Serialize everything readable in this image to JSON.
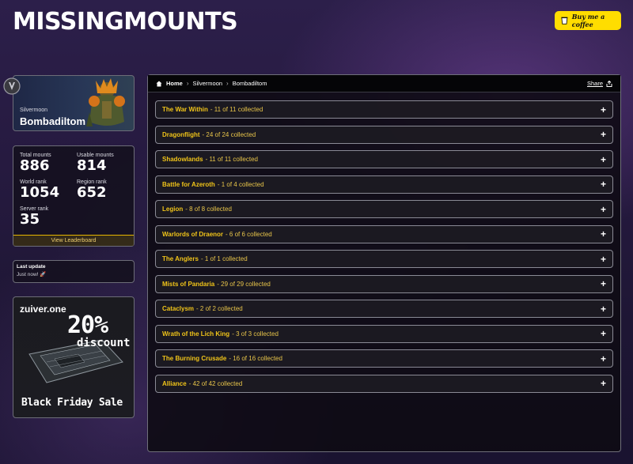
{
  "header": {
    "logo": "MISSINGMOUNTS",
    "coffee_label": "Buy me a coffee"
  },
  "character": {
    "realm": "Silvermoon",
    "name": "Bombadiltom"
  },
  "stats": {
    "total_mounts_label": "Total mounts",
    "total_mounts": "886",
    "usable_mounts_label": "Usable mounts",
    "usable_mounts": "814",
    "world_rank_label": "World rank",
    "world_rank": "1054",
    "region_rank_label": "Region rank",
    "region_rank": "652",
    "server_rank_label": "Server rank",
    "server_rank": "35",
    "leaderboard_label": "View Leaderboard"
  },
  "last_update": {
    "title": "Last update",
    "value": "Just now! 🚀"
  },
  "ad": {
    "brand": "zuiver.one",
    "percent": "20%",
    "discount": "discount",
    "sale": "Black Friday Sale"
  },
  "breadcrumb": {
    "home": "Home",
    "realm": "Silvermoon",
    "character": "Bombadiltom",
    "share": "Share"
  },
  "expansions": [
    {
      "name": "The War Within",
      "count": "- 11 of 11 collected"
    },
    {
      "name": "Dragonflight",
      "count": "- 24 of 24 collected"
    },
    {
      "name": "Shadowlands",
      "count": "- 11 of 11 collected"
    },
    {
      "name": "Battle for Azeroth",
      "count": "- 1 of 4 collected"
    },
    {
      "name": "Legion",
      "count": "- 8 of 8 collected"
    },
    {
      "name": "Warlords of Draenor",
      "count": "- 6 of 6 collected"
    },
    {
      "name": "The Anglers",
      "count": "- 1 of 1 collected"
    },
    {
      "name": "Mists of Pandaria",
      "count": "- 29 of 29 collected"
    },
    {
      "name": "Cataclysm",
      "count": "- 2 of 2 collected"
    },
    {
      "name": "Wrath of the Lich King",
      "count": "- 3 of 3 collected"
    },
    {
      "name": "The Burning Crusade",
      "count": "- 16 of 16 collected"
    },
    {
      "name": "Alliance",
      "count": "- 42 of 42 collected"
    }
  ],
  "colors": {
    "accent_yellow": "#f0c419",
    "coffee_yellow": "#ffdd00"
  }
}
